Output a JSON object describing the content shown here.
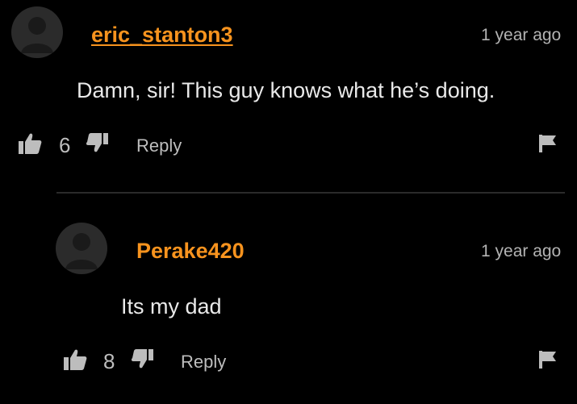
{
  "colors": {
    "username": "#f7931e",
    "background": "#000000",
    "muted": "#b3b3b3"
  },
  "comments": [
    {
      "username": "eric_stanton3",
      "timestamp": "1 year ago",
      "text": "Damn, sir! This guy knows what he’s doing.",
      "likes": "6",
      "reply_label": "Reply",
      "icons": {
        "avatar": "user-avatar-icon",
        "like": "thumbs-up-icon",
        "dislike": "thumbs-down-icon",
        "flag": "flag-icon"
      }
    },
    {
      "username": "Perake420",
      "timestamp": "1 year ago",
      "text": "Its my dad",
      "likes": "8",
      "reply_label": "Reply",
      "icons": {
        "avatar": "user-avatar-icon",
        "like": "thumbs-up-icon",
        "dislike": "thumbs-down-icon",
        "flag": "flag-icon"
      }
    }
  ]
}
